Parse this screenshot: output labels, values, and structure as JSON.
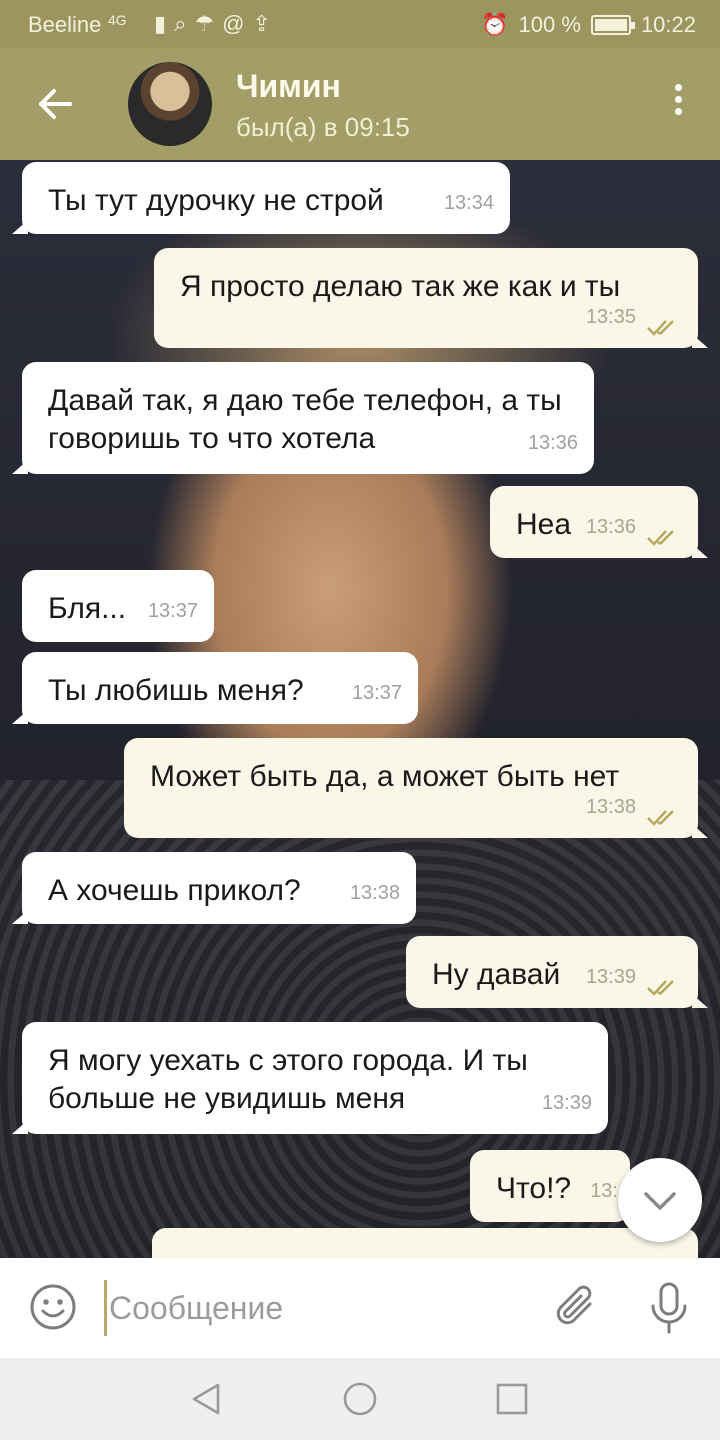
{
  "status_bar": {
    "carrier": "Beeline",
    "network": "4G",
    "battery": "100 %",
    "time": "10:22"
  },
  "header": {
    "contact_name": "Чимин",
    "contact_status": "был(а) в 09:15"
  },
  "messages": [
    {
      "dir": "in",
      "text": "Ты тут дурочку не строй",
      "time": "13:34"
    },
    {
      "dir": "out",
      "text": "Я просто делаю так же как и ты",
      "time": "13:35"
    },
    {
      "dir": "in",
      "text": "Давай так, я даю тебе телефон, а ты говоришь то что хотела",
      "time": "13:36"
    },
    {
      "dir": "out",
      "text": "Неа",
      "time": "13:36"
    },
    {
      "dir": "in",
      "text": "Бля...",
      "time": "13:37"
    },
    {
      "dir": "in",
      "text": "Ты любишь меня?",
      "time": "13:37"
    },
    {
      "dir": "out",
      "text": "Может быть да, а может быть нет",
      "time": "13:38"
    },
    {
      "dir": "in",
      "text": "А хочешь прикол?",
      "time": "13:38"
    },
    {
      "dir": "out",
      "text": "Ну давай",
      "time": "13:39"
    },
    {
      "dir": "in",
      "text": "Я могу уехать с этого города. И ты больше не увидишь меня",
      "time": "13:39"
    },
    {
      "dir": "out",
      "text": "Что!?",
      "time": "13:"
    }
  ],
  "composer": {
    "placeholder": "Сообщение"
  },
  "colors": {
    "header": "#a39d68",
    "status_bar": "#9c9560",
    "outgoing_bubble": "#faf6e8",
    "incoming_bubble": "#ffffff",
    "read_ticks": "#b5a75a"
  }
}
